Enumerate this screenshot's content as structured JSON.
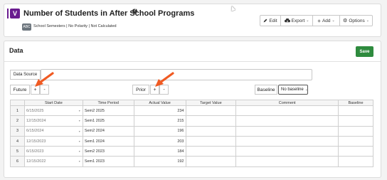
{
  "header": {
    "badge_letter": "V",
    "title": "Number of Students in After School Programs",
    "help_glyph": "?",
    "tag_label": "ABC",
    "meta_text": "School Semesters | No Polarity | Not Calculated",
    "buttons": {
      "edit": "Edit",
      "export": "Export",
      "add": "Add",
      "options": "Options"
    }
  },
  "data_section": {
    "title": "Data",
    "save_label": "Save",
    "data_source_label": "Data Source",
    "data_source_value": "",
    "future_label": "Future",
    "prior_label": "Prior",
    "plus": "+",
    "minus": "-",
    "baseline_label": "Baseline",
    "baseline_value": "No baseline"
  },
  "table": {
    "headers": [
      "Start Date",
      "Time Period",
      "Actual Value",
      "Target Value",
      "Comment",
      "Baseline"
    ],
    "rows": [
      {
        "n": "1",
        "start": "6/15/2025",
        "period": "Sem2 2025",
        "actual": "234",
        "target": "",
        "comment": "",
        "baseline": ""
      },
      {
        "n": "2",
        "start": "12/15/2024",
        "period": "Sem1 2025",
        "actual": "215",
        "target": "",
        "comment": "",
        "baseline": ""
      },
      {
        "n": "3",
        "start": "6/15/2024",
        "period": "Sem2 2024",
        "actual": "196",
        "target": "",
        "comment": "",
        "baseline": ""
      },
      {
        "n": "4",
        "start": "12/15/2023",
        "period": "Sem1 2024",
        "actual": "203",
        "target": "",
        "comment": "",
        "baseline": ""
      },
      {
        "n": "5",
        "start": "6/15/2023",
        "period": "Sem2 2023",
        "actual": "184",
        "target": "",
        "comment": "",
        "baseline": ""
      },
      {
        "n": "6",
        "start": "12/15/2022",
        "period": "Sem1 2023",
        "actual": "192",
        "target": "",
        "comment": "",
        "baseline": ""
      }
    ]
  },
  "colors": {
    "brand_purple": "#6a1b8f",
    "save_green": "#2e8b3e",
    "annotation_arrow": "#f05a22"
  }
}
